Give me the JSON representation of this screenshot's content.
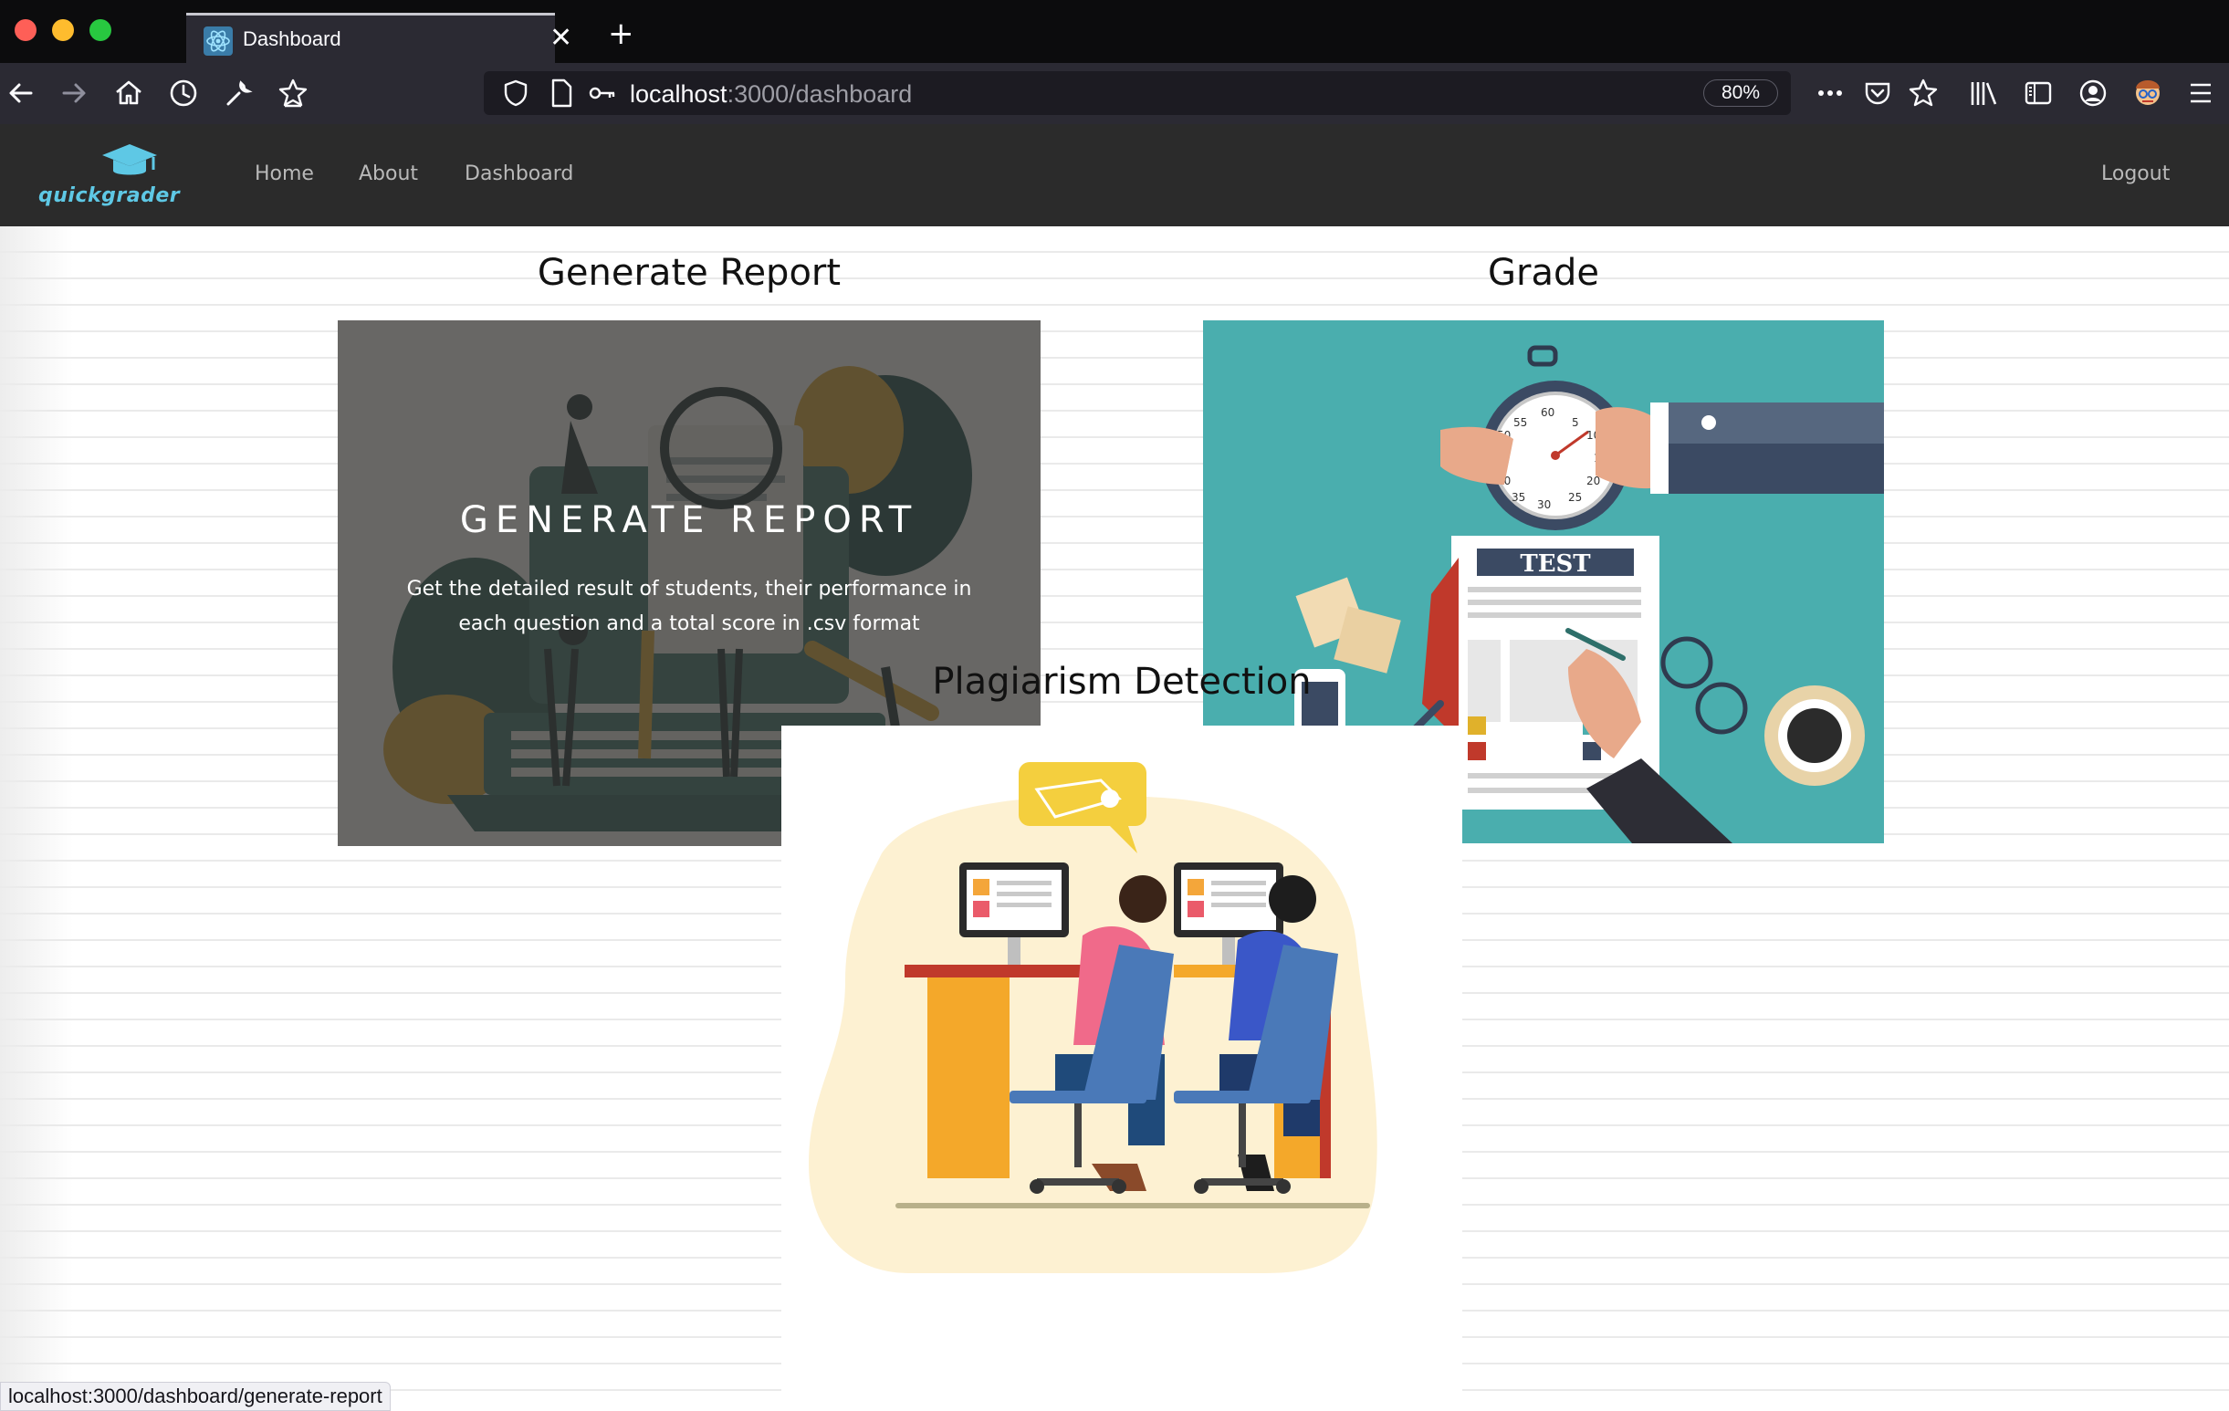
{
  "browser": {
    "tab_title": "Dashboard",
    "url_host": "localhost",
    "url_path": ":3000/dashboard",
    "zoom": "80%",
    "status_url": "localhost:3000/dashboard/generate-report"
  },
  "nav": {
    "logo_text": "quickgrader",
    "links": [
      "Home",
      "About",
      "Dashboard"
    ],
    "logout": "Logout"
  },
  "sections": {
    "report": {
      "title": "Generate Report",
      "overlay_title": "GENERATE REPORT",
      "overlay_desc": "Get the detailed result of students, their performance in each question and a total score in .csv format"
    },
    "grade": {
      "title": "Grade",
      "sheet_label": "TEST"
    },
    "plagiarism": {
      "title": "Plagiarism Detection"
    }
  },
  "colors": {
    "nav_bg": "#2b2b2b",
    "logo_accent": "#5ec8e5",
    "grade_bg": "#4aaeae"
  }
}
